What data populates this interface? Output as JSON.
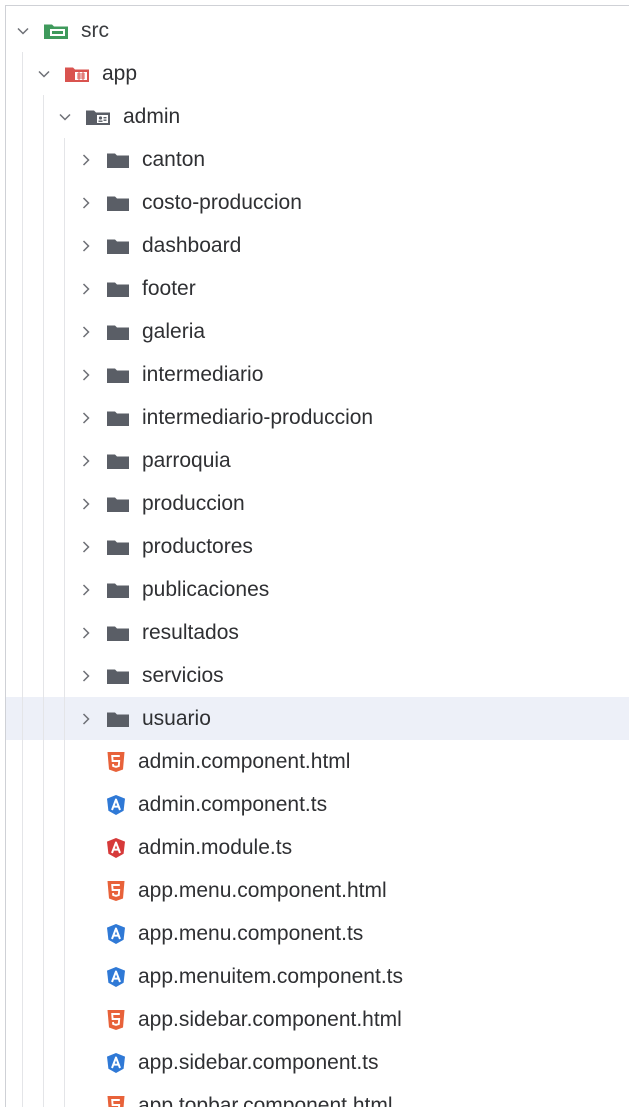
{
  "tree": {
    "root": {
      "label": "src",
      "icon": "source-root-folder-icon"
    },
    "app": {
      "label": "app",
      "icon": "app-module-folder-icon"
    },
    "admin": {
      "label": "admin",
      "icon": "admin-module-folder-icon"
    },
    "folders": [
      "canton",
      "costo-produccion",
      "dashboard",
      "footer",
      "galeria",
      "intermediario",
      "intermediario-produccion",
      "parroquia",
      "produccion",
      "productores",
      "publicaciones",
      "resultados",
      "servicios",
      "usuario"
    ],
    "selected_folder": "usuario",
    "files": [
      {
        "name": "admin.component.html",
        "type": "html"
      },
      {
        "name": "admin.component.ts",
        "type": "angular-component"
      },
      {
        "name": "admin.module.ts",
        "type": "angular-module"
      },
      {
        "name": "app.menu.component.html",
        "type": "html"
      },
      {
        "name": "app.menu.component.ts",
        "type": "angular-component"
      },
      {
        "name": "app.menuitem.component.ts",
        "type": "angular-component"
      },
      {
        "name": "app.sidebar.component.html",
        "type": "html"
      },
      {
        "name": "app.sidebar.component.ts",
        "type": "angular-component"
      },
      {
        "name": "app.topbar.component.html",
        "type": "html"
      }
    ]
  },
  "colors": {
    "folder": "#5a5e66",
    "html": "#e8623a",
    "angular_component": "#2f79d6",
    "angular_module": "#d63a3a",
    "source_root": "#3f9a5c",
    "selection": "#edf0f8"
  }
}
